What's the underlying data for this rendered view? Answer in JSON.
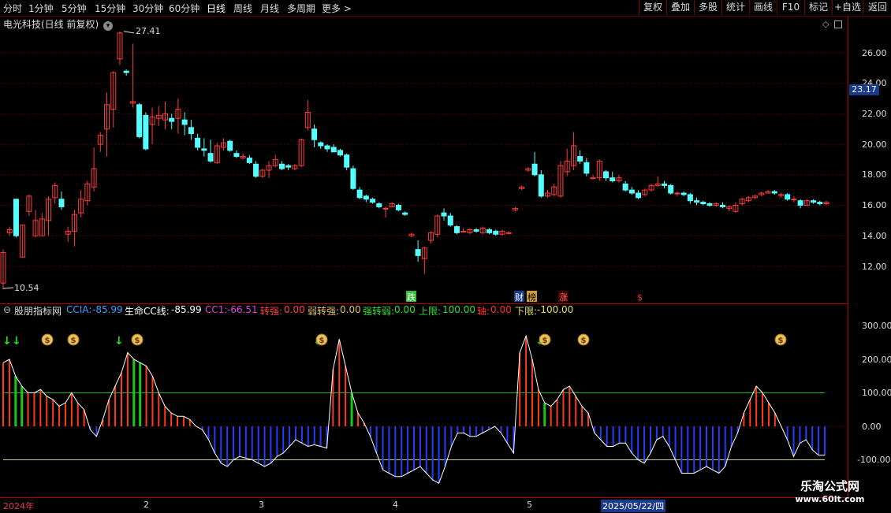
{
  "toolbar": {
    "timeframes": [
      "分时",
      "1分钟",
      "5分钟",
      "15分钟",
      "30分钟",
      "60分钟",
      "日线",
      "周线",
      "月线",
      "多周期",
      "更多 >"
    ],
    "active": "日线",
    "right_buttons": [
      "复权",
      "叠加",
      "多股",
      "统计",
      "画线",
      "F10",
      "标记",
      "+自选",
      "返回"
    ]
  },
  "stock_title": "电光科技(日线 前复权)",
  "price_axis": {
    "ticks": [
      "26.00",
      "24.00",
      "22.00",
      "20.00",
      "18.00",
      "16.00",
      "14.00",
      "12.00"
    ],
    "current_price": "23.17"
  },
  "annotations": {
    "high_label": "27.41",
    "low_label": "10.54",
    "event_markers": [
      "跌",
      "财",
      "榜",
      "涨",
      "$"
    ]
  },
  "indicator": {
    "name": "股朋指标网",
    "ccia_label": "CCIA:",
    "ccia_value": "-85.99",
    "sm_label": "生命CC线:",
    "sm_value": "-85.99",
    "cc1_label": "CC1:",
    "cc1_value": "-66.51",
    "zq_label": "转强:",
    "zq_value": "0.00",
    "rzq_label": "弱转强:",
    "rzq_value": "0.00",
    "qzr_label": "强转弱:",
    "qzr_value": "0.00",
    "up_label": "上限:",
    "up_value": "100.00",
    "axis_label": "轴:",
    "axis_value": "0.00",
    "down_label": "下限:",
    "down_value": "-100.00"
  },
  "sub_axis": {
    "ticks": [
      "300.00",
      "200.00",
      "100.00",
      "0.00",
      "-100.00"
    ]
  },
  "dates": {
    "year": "2024年",
    "months": [
      "2",
      "3",
      "4",
      "5"
    ],
    "cursor_date": "2025/05/22/四"
  },
  "watermark": {
    "line1": "乐淘公式网",
    "line2": "www.60lt.com"
  },
  "colors": {
    "up": "#ff3b3b",
    "down": "#54ffff",
    "pos_bar": "#ff3b1a",
    "neg_bar": "#2040ff",
    "green": "#18c818"
  }
}
